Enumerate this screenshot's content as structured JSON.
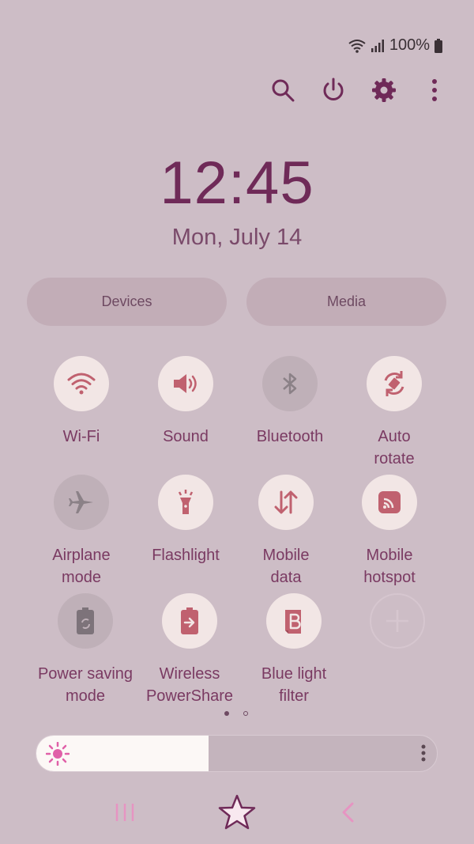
{
  "status": {
    "battery_text": "100%"
  },
  "toolbar": {
    "icons": [
      "search-icon",
      "power-icon",
      "gear-icon",
      "more-icon"
    ]
  },
  "clock": {
    "time": "12:45",
    "date": "Mon, July 14"
  },
  "pills": {
    "devices": "Devices",
    "media": "Media"
  },
  "tiles": [
    {
      "label": "Wi-Fi",
      "icon": "wifi-icon",
      "state": "on"
    },
    {
      "label": "Sound",
      "icon": "sound-icon",
      "state": "on"
    },
    {
      "label": "Bluetooth",
      "icon": "bluetooth-icon",
      "state": "off"
    },
    {
      "label": "Auto\nrotate",
      "icon": "auto-rotate-icon",
      "state": "on"
    },
    {
      "label": "Airplane\nmode",
      "icon": "airplane-icon",
      "state": "off"
    },
    {
      "label": "Flashlight",
      "icon": "flashlight-icon",
      "state": "on"
    },
    {
      "label": "Mobile\ndata",
      "icon": "mobile-data-icon",
      "state": "on"
    },
    {
      "label": "Mobile\nhotspot",
      "icon": "hotspot-icon",
      "state": "on"
    },
    {
      "label": "Power saving\nmode",
      "icon": "battery-saver-icon",
      "state": "off"
    },
    {
      "label": "Wireless\nPowerShare",
      "icon": "powershare-icon",
      "state": "on"
    },
    {
      "label": "Blue light\nfilter",
      "icon": "blue-light-icon",
      "state": "on"
    }
  ],
  "page_indicator": {
    "current": 1,
    "total": 2
  },
  "brightness": {
    "level": 0.43
  },
  "colors": {
    "accent": "#6f2a58",
    "icon_active": "#c0616f",
    "background": "#cdbdc6"
  }
}
